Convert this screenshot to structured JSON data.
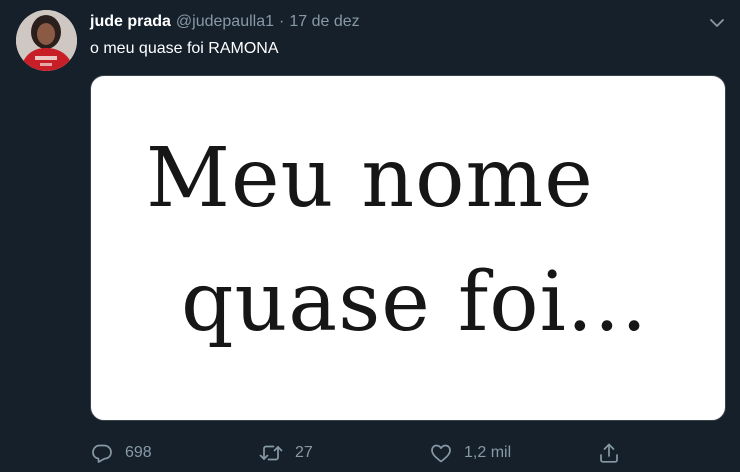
{
  "tweet": {
    "author": {
      "display_name": "jude prada",
      "handle": "@judepaulla1"
    },
    "separator": "·",
    "timestamp": "17 de dez",
    "text": "o meu quase foi RAMONA",
    "media": {
      "line1": "Meu nome",
      "line2": "quase foi..."
    },
    "actions": {
      "reply_count": "698",
      "retweet_count": "27",
      "like_count": "1,2 mil"
    }
  },
  "icons": {
    "avatar": "avatar",
    "menu": "chevron-down-icon",
    "reply": "reply-icon",
    "retweet": "retweet-icon",
    "like": "heart-icon",
    "share": "share-icon"
  },
  "colors": {
    "background": "#15202b",
    "secondary_text": "#8899a6",
    "primary_text": "#ffffff"
  }
}
